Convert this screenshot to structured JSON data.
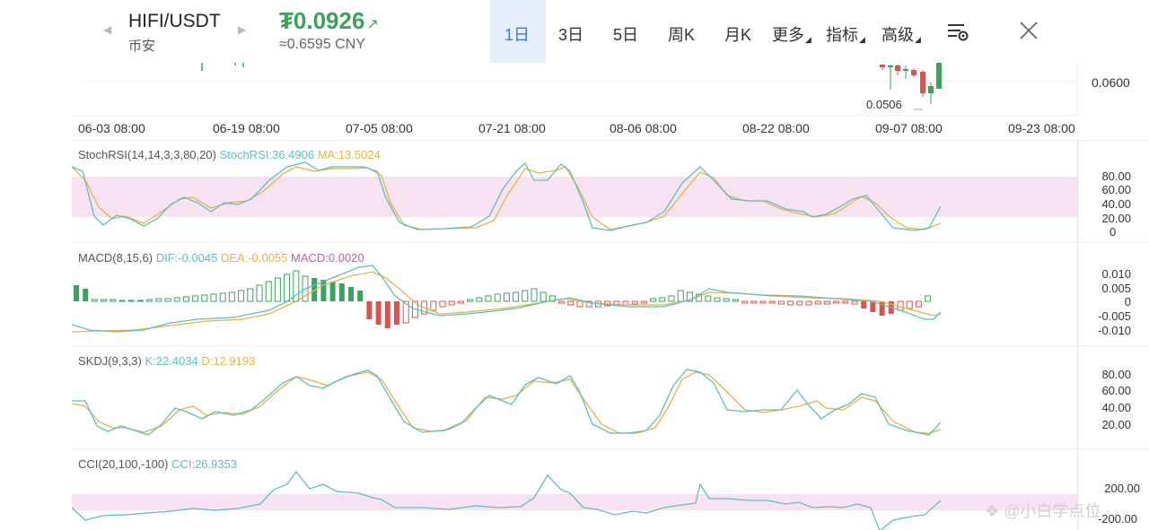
{
  "header": {
    "pair": "HIFI/USDT",
    "exchange": "币安",
    "price": "₮0.0926",
    "price_arrow": "↗",
    "price_cny": "≈0.6595 CNY",
    "prev_icon": "triangle-left-icon",
    "next_icon": "triangle-right-icon",
    "tabs": [
      {
        "label": "1日",
        "active": true
      },
      {
        "label": "3日"
      },
      {
        "label": "5日"
      },
      {
        "label": "周K"
      },
      {
        "label": "月K"
      },
      {
        "label": "更多"
      },
      {
        "label": "指标"
      },
      {
        "label": "高级"
      }
    ],
    "settings_icon": "chart-settings-icon",
    "close_icon": "close-icon"
  },
  "price_chart": {
    "axis_label": "0.0600",
    "low_label": "0.0506"
  },
  "dates": [
    "06-03 08:00",
    "06-19 08:00",
    "07-05 08:00",
    "07-21 08:00",
    "08-06 08:00",
    "08-22 08:00",
    "09-07 08:00",
    "09-23 08:00"
  ],
  "stochrsi": {
    "name": "StochRSI(14,14,3,3,80,20)",
    "value": "StochRSI:36.4906",
    "ma": "MA:13.5024",
    "axis": [
      "80.00",
      "60.00",
      "40.00",
      "20.00",
      "0"
    ]
  },
  "macd": {
    "name": "MACD(8,15,6)",
    "dif": "DIF:-0.0045",
    "dea": "DEA:-0.0055",
    "macd": "MACD:0.0020",
    "axis": [
      "0.010",
      "0.005",
      "0",
      "-0.005",
      "-0.010"
    ]
  },
  "skdj": {
    "name": "SKDJ(9,3,3)",
    "k": "K:22.4034",
    "d": "D:12.9193",
    "axis": [
      "80.00",
      "60.00",
      "40.00",
      "20.00"
    ]
  },
  "cci": {
    "name": "CCI(20,100,-100)",
    "value": "CCI:26.9353",
    "axis": [
      "200.00",
      "-200.00"
    ]
  },
  "watermark": "@小白学点位",
  "colors": {
    "up": "#3aa35b",
    "down": "#d9534f",
    "teal": "#5bbfbf",
    "orange": "#e8b23e",
    "band": "#f7e2f2",
    "accent": "#3c78d8"
  }
}
